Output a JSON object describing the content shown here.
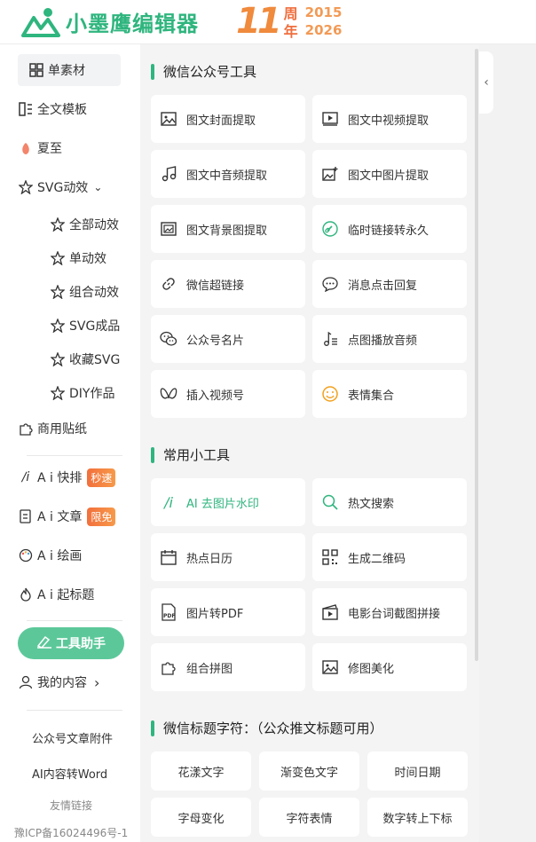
{
  "header": {
    "app_name": "小墨鹰编辑器",
    "anniversary_number": "11",
    "anniversary_char_1": "周",
    "anniversary_char_2": "年",
    "year_start": "2015",
    "year_end": "2026"
  },
  "sidebar": {
    "items": [
      {
        "label": "单素材",
        "icon": "grid-icon"
      },
      {
        "label": "全文模板",
        "icon": "template-icon"
      },
      {
        "label": "夏至",
        "icon": "peach-icon"
      },
      {
        "label": "SVG动效",
        "icon": "star-icon",
        "chevron": "⌄"
      }
    ],
    "svg_sub": [
      {
        "label": "全部动效",
        "icon": "star-icon"
      },
      {
        "label": "单动效",
        "icon": "star-icon"
      },
      {
        "label": "组合动效",
        "icon": "star-icon"
      },
      {
        "label": "SVG成品",
        "icon": "star-icon"
      },
      {
        "label": "收藏SVG",
        "icon": "star-icon"
      },
      {
        "label": "DIY作品",
        "icon": "star-icon"
      }
    ],
    "sticker": {
      "label": "商用贴纸",
      "icon": "puzzle-icon"
    },
    "ai": [
      {
        "label": "A i 快排",
        "badge": "秒速"
      },
      {
        "label": "A i 文章",
        "badge": "限免"
      },
      {
        "label": "A i 绘画",
        "badge": ""
      },
      {
        "label": "A i 起标题",
        "badge": ""
      }
    ],
    "tool_button": "工具助手",
    "my_content": "我的内容",
    "my_content_chevron": "›",
    "attachments": "公众号文章附件",
    "ai_word": "AI内容转Word",
    "friend_links": "友情链接",
    "icp": "豫ICP备16024496号-1"
  },
  "main": {
    "wechat_tools_title": "微信公众号工具",
    "wechat_tools": [
      {
        "label": "图文封面提取",
        "icon": "image-icon"
      },
      {
        "label": "图文中视频提取",
        "icon": "video-icon"
      },
      {
        "label": "图文中音频提取",
        "icon": "music-icon"
      },
      {
        "label": "图文中图片提取",
        "icon": "image-plus-icon"
      },
      {
        "label": "图文背景图提取",
        "icon": "image-bg-icon"
      },
      {
        "label": "临时链接转永久",
        "icon": "link-icon"
      },
      {
        "label": "微信超链接",
        "icon": "chain-icon"
      },
      {
        "label": "消息点击回复",
        "icon": "message-icon"
      },
      {
        "label": "公众号名片",
        "icon": "wechat-icon"
      },
      {
        "label": "点图播放音频",
        "icon": "audio-list-icon"
      },
      {
        "label": "插入视频号",
        "icon": "butterfly-icon"
      },
      {
        "label": "表情集合",
        "icon": "smile-icon"
      }
    ],
    "common_tools_title": "常用小工具",
    "common_tools": [
      {
        "label": "AI 去图片水印",
        "icon": "ai-icon"
      },
      {
        "label": "热文搜索",
        "icon": "search-icon"
      },
      {
        "label": "热点日历",
        "icon": "calendar-icon"
      },
      {
        "label": "生成二维码",
        "icon": "qrcode-icon"
      },
      {
        "label": "图片转PDF",
        "icon": "pdf-icon"
      },
      {
        "label": "电影台词截图拼接",
        "icon": "film-icon"
      },
      {
        "label": "组合拼图",
        "icon": "puzzle-icon"
      },
      {
        "label": "修图美化",
        "icon": "image-icon"
      }
    ],
    "title_chars_title": "微信标题字符：（公众推文标题可用）",
    "title_chars": [
      "花漾文字",
      "渐变色文字",
      "时间日期",
      "字母变化",
      "字符表情",
      "数字转上下标"
    ]
  },
  "right": {
    "collapse_arrow": "‹"
  },
  "colors": {
    "brand": "#2fb57e",
    "tool_button": "#5cc89a",
    "badge": "#f26f3c"
  }
}
